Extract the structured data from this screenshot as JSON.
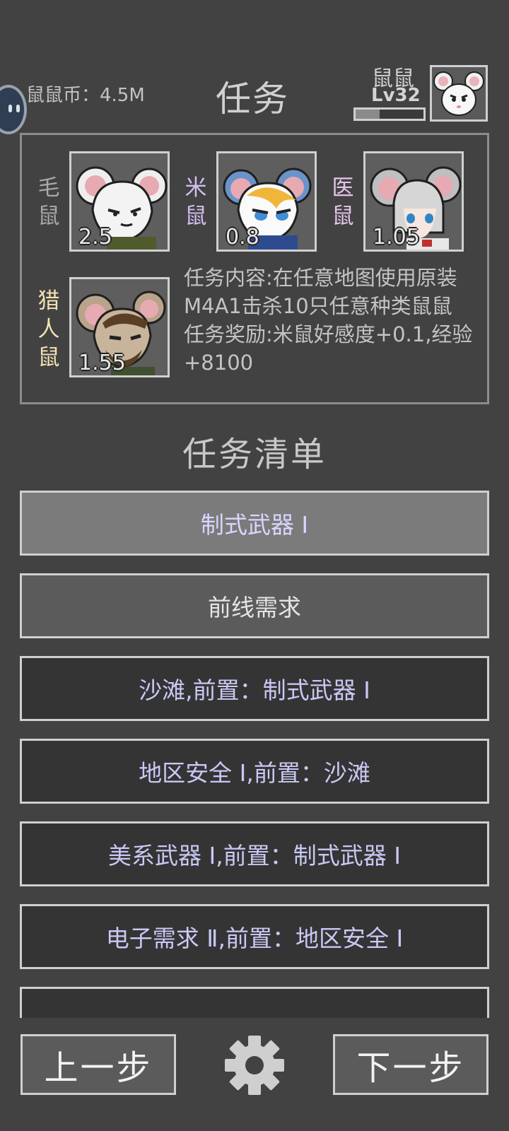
{
  "header": {
    "coins_label": "鼠鼠币：4.5M",
    "title": "任务",
    "player_name": "鼠鼠",
    "player_level": "Lv32",
    "xp_fraction": 0.35
  },
  "team": [
    {
      "name": "毛鼠",
      "value": "2.5",
      "name_color": "#a8a8a8"
    },
    {
      "name": "米鼠",
      "value": "0.8",
      "name_color": "#d2bef0"
    },
    {
      "name": "医鼠",
      "value": "1.05",
      "name_color": "#e6c3ea"
    },
    {
      "name": "猎人鼠",
      "value": "1.55",
      "name_color": "#f4e2b4"
    }
  ],
  "task_info": {
    "content": "任务内容:在任意地图使用原装M4A1击杀10只任意种类鼠鼠",
    "reward": "任务奖励:米鼠好感度+0.1,经验+8100"
  },
  "list_title": "任务清单",
  "tasks": [
    {
      "label": "制式武器 Ⅰ",
      "state": "selected"
    },
    {
      "label": "前线需求",
      "state": "available"
    },
    {
      "label": "沙滩,前置：制式武器 Ⅰ",
      "state": "locked"
    },
    {
      "label": "地区安全 Ⅰ,前置：沙滩",
      "state": "locked"
    },
    {
      "label": "美系武器 Ⅰ,前置：制式武器 Ⅰ",
      "state": "locked"
    },
    {
      "label": "电子需求 Ⅱ,前置：地区安全 Ⅰ",
      "state": "locked"
    },
    {
      "label": "",
      "state": "locked"
    }
  ],
  "buttons": {
    "prev": "上一步",
    "next": "下一步"
  },
  "icons": {
    "settings": "gear-icon",
    "side": "drawer-tab-icon"
  }
}
